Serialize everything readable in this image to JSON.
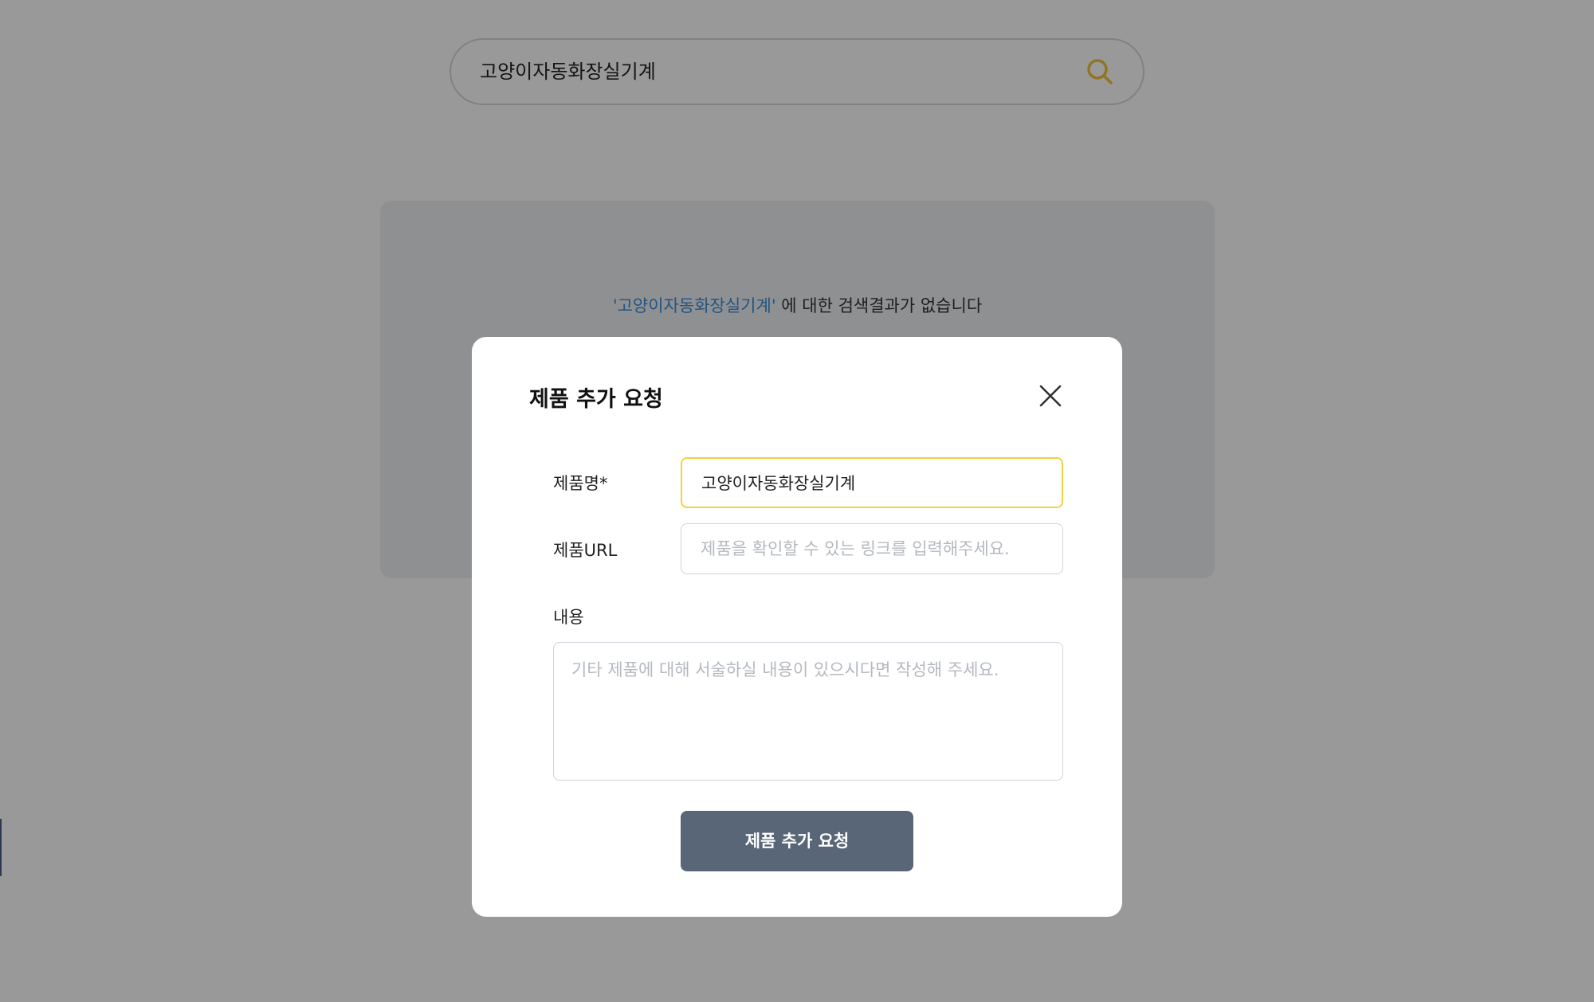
{
  "search": {
    "value": "고양이자동화장실기계",
    "icon": "search-icon",
    "icon_color": "#f3c43a"
  },
  "results": {
    "keyword": "'고양이자동화장실기계'",
    "message": " 에 대한 검색결과가 없습니다",
    "keyword_color": "#3d8ed8"
  },
  "modal": {
    "title": "제품 추가 요청",
    "close_icon": "close-icon",
    "fields": {
      "name": {
        "label": "제품명*",
        "value": "고양이자동화장실기계"
      },
      "url": {
        "label": "제품URL",
        "placeholder": "제품을 확인할 수 있는 링크를 입력해주세요."
      },
      "content": {
        "label": "내용",
        "placeholder": "기타 제품에 대해 서술하실 내용이 있으시다면 작성해 주세요."
      }
    },
    "submit_label": "제품 추가 요청",
    "submit_color": "#586677",
    "focus_color": "#f3d23f"
  }
}
